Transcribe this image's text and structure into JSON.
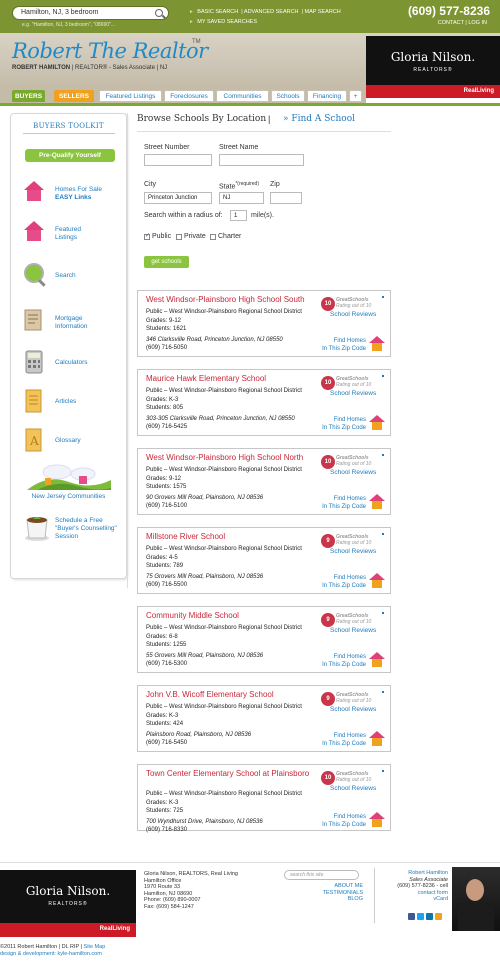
{
  "topbar": {
    "search_value": "Hamilton, NJ, 3 bedroom",
    "search_hint": "e.g. \"Hamilton, NJ, 3 bedroom\", \"08690\"...",
    "links": [
      "BASIC SEARCH",
      "ADVANCED SEARCH",
      "MAP SEARCH"
    ],
    "saved_searches": "MY SAVED SEARCHES",
    "phone": "(609) 577-8236",
    "contact": "CONTACT",
    "login": "LOG IN"
  },
  "header": {
    "logo": "Robert The Realtor",
    "tm": "TM",
    "agent_name": "ROBERT HAMILTON",
    "agent_title": "REALTOR® - Sales Associate",
    "state": "NJ",
    "brand_title": "Gloria Nilson.",
    "brand_sub": "REALTORS®",
    "brand_tag": "RealLiving"
  },
  "nav": {
    "tabs": [
      "BUYERS",
      "SELLERS",
      "Featured Listings",
      "Foreclosures",
      "Communities",
      "Schools",
      "Financing",
      "+"
    ]
  },
  "sidebar": {
    "title": "BUYERS TOOLKIT",
    "prequal": "Pre-Qualify Yourself",
    "items": [
      {
        "label": "Homes For Sale",
        "label2": "EASY Links",
        "icon": "house-icon"
      },
      {
        "label": "Featured",
        "label2": "Listings",
        "icon": "house-icon"
      },
      {
        "label": "Search",
        "label2": "",
        "icon": "magnifier-icon"
      },
      {
        "label": "Mortgage",
        "label2": "Information",
        "icon": "document-icon"
      },
      {
        "label": "Calculators",
        "label2": "",
        "icon": "calculator-icon"
      },
      {
        "label": "Articles",
        "label2": "",
        "icon": "articles-icon"
      },
      {
        "label": "Glossary",
        "label2": "",
        "icon": "glossary-icon"
      },
      {
        "label": "New Jersey Communities",
        "label2": "",
        "icon": "landscape-icon"
      },
      {
        "label": "Schedule a Free",
        "label2": "\"Buyer's Counselling\"",
        "label3": "Session",
        "icon": "coffee-icon"
      }
    ]
  },
  "form": {
    "heading": "Browse Schools By Location",
    "separator": "|",
    "find_link": "» Find A School",
    "street_number_label": "Street Number",
    "street_name_label": "Street Name",
    "city_label": "City",
    "city_value": "Princeton Junction",
    "state_label": "State",
    "state_required": "*(required)",
    "state_value": "NJ",
    "zip_label": "Zip",
    "radius_prefix": "Search within a radius of:",
    "radius_value": "1",
    "radius_suffix": "mile(s).",
    "public_label": "Public",
    "private_label": "Private",
    "charter_label": "Charter",
    "submit": "get schools"
  },
  "schools": [
    {
      "name": "West Windsor-Plainsboro High School South",
      "type": "Public – West Windsor-Plainsboro Regional School District",
      "grades": "Grades: 9-12",
      "students": "Students: 1621",
      "address": "346 Clarksville Road, Princeton Junction, NJ 08550",
      "phone": "(609) 716-5050",
      "rating": "10"
    },
    {
      "name": "Maurice Hawk Elementary School",
      "type": "Public – West Windsor-Plainsboro Regional School District",
      "grades": "Grades: K-3",
      "students": "Students: 805",
      "address": "303-305 Clarksville Road, Princeton Junction, NJ 08550",
      "phone": "(609) 716-5425",
      "rating": "10"
    },
    {
      "name": "West Windsor-Plainsboro High School North",
      "type": "Public – West Windsor-Plainsboro Regional School District",
      "grades": "Grades: 9-12",
      "students": "Students: 1575",
      "address": "90 Grovers Mill Road, Plainsboro, NJ 08536",
      "phone": "(609) 716-5100",
      "rating": "10"
    },
    {
      "name": "Millstone River School",
      "type": "Public – West Windsor-Plainsboro Regional School District",
      "grades": "Grades: 4-5",
      "students": "Students: 789",
      "address": "75 Grovers Mill Road, Plainsboro, NJ 08536",
      "phone": "(609) 716-5500",
      "rating": "9"
    },
    {
      "name": "Community Middle School",
      "type": "Public – West Windsor-Plainsboro Regional School District",
      "grades": "Grades: 6-8",
      "students": "Students: 1255",
      "address": "55 Grovers Mill Road, Plainsboro, NJ 08536",
      "phone": "(609) 716-5300",
      "rating": "9"
    },
    {
      "name": "John V.B. Wicoff Elementary School",
      "type": "Public – West Windsor-Plainsboro Regional School District",
      "grades": "Grades: K-3",
      "students": "Students: 424",
      "address": "Plainsboro Road, Plainsboro, NJ 08536",
      "phone": "(609) 716-5450",
      "rating": "9"
    },
    {
      "name": "Town Center Elementary School at Plainsboro",
      "type": "Public – West Windsor-Plainsboro Regional School District",
      "grades": "Grades: K-3",
      "students": "Students: 725",
      "address": "700 Wyndhurst Drive, Plainsboro, NJ 08536",
      "phone": "(609) 716-8330",
      "rating": "10"
    }
  ],
  "card_labels": {
    "gs_line1": "GreatSchools",
    "gs_line2": "Rating out of 10",
    "reviews": "School Reviews",
    "find1": "Find Homes",
    "find2": "In This Zip Code"
  },
  "footer": {
    "brand_title": "Gloria Nilson.",
    "brand_sub": "REALTORS®",
    "brand_tag": "RealLiving",
    "addr": [
      "Gloria Nilson, REALTORS, Real Living",
      "Hamilton Office",
      "1970 Route 33",
      "Hamilton, NJ 08690",
      "Phone: (609) 890-0007",
      "Fax: (609) 584-1247"
    ],
    "search_placeholder": "search this site",
    "links": [
      "ABOUT ME",
      "TESTIMONIALS",
      "BLOG"
    ],
    "agent_name": "Robert Hamilton",
    "agent_title": "Sales Associate",
    "agent_phone": "(609) 577-8236 - cell",
    "contact_form": "contact form",
    "vcard": "vCard",
    "copyright": "©2011 Robert Hamilton  |  DL RIP  |",
    "sitemap": "Site Map",
    "design": "design & development: kyle-hamilton.com"
  },
  "colors": {
    "accent": "#1f7bbd",
    "green": "#7d9432",
    "school_red": "#c8283a",
    "brand_red": "#cc1a26"
  }
}
